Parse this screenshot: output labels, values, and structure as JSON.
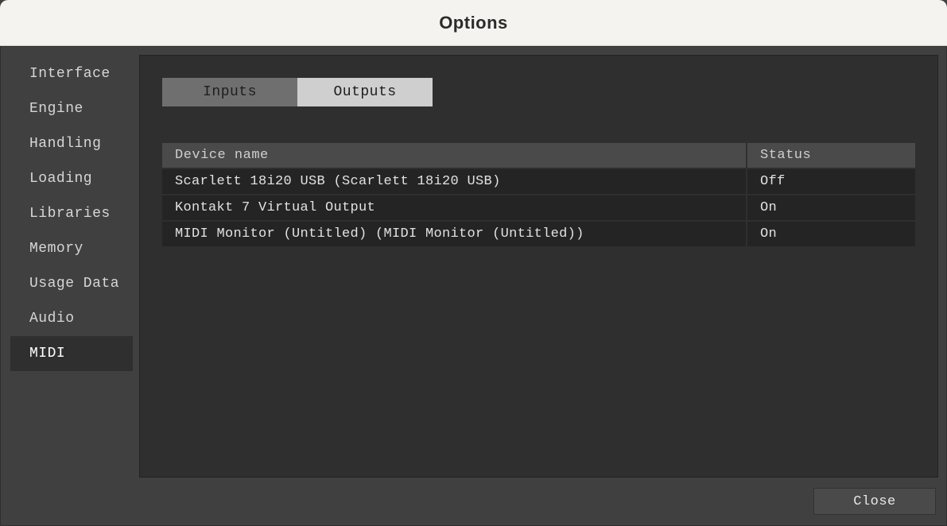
{
  "window": {
    "title": "Options"
  },
  "sidebar": {
    "items": [
      {
        "label": "Interface"
      },
      {
        "label": "Engine"
      },
      {
        "label": "Handling"
      },
      {
        "label": "Loading"
      },
      {
        "label": "Libraries"
      },
      {
        "label": "Memory"
      },
      {
        "label": "Usage Data"
      },
      {
        "label": "Audio"
      },
      {
        "label": "MIDI"
      }
    ],
    "active_index": 8
  },
  "tabs": {
    "items": [
      {
        "label": "Inputs"
      },
      {
        "label": "Outputs"
      }
    ],
    "active_index": 1
  },
  "table": {
    "headers": {
      "device": "Device name",
      "status": "Status"
    },
    "rows": [
      {
        "device": "Scarlett 18i20 USB (Scarlett 18i20 USB)",
        "status": "Off"
      },
      {
        "device": "Kontakt 7 Virtual Output",
        "status": "On"
      },
      {
        "device": "MIDI Monitor (Untitled) (MIDI Monitor (Untitled))",
        "status": "On"
      }
    ]
  },
  "footer": {
    "close_label": "Close"
  }
}
